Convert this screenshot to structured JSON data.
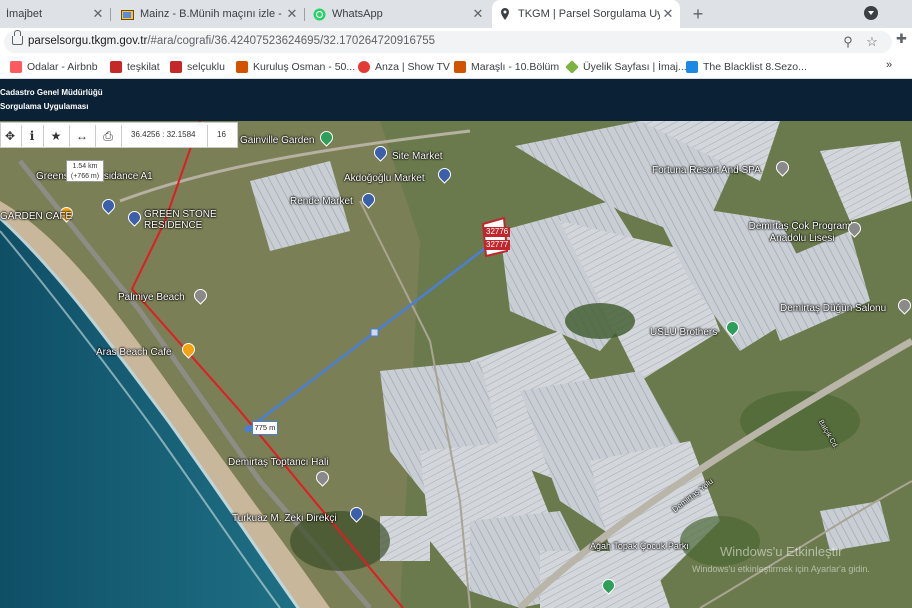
{
  "tabs": [
    {
      "label": "İmajbet",
      "icon": "generic-tab-icon"
    },
    {
      "label": "Mainz - B.Münih maçını izle - İmajbet",
      "icon": "tv-icon"
    },
    {
      "label": "WhatsApp",
      "icon": "whatsapp-icon"
    },
    {
      "label": "TKGM | Parsel Sorgulama Uygulaması",
      "icon": "location-pin-icon",
      "active": true
    }
  ],
  "url": {
    "host": "parselsorgu.tkgm.gov.tr",
    "path": "/#ara/cografi/36.42407523624695/32.170264720916755"
  },
  "bookmarks": [
    {
      "label": "Odalar - Airbnb",
      "color": "#ff5a5f"
    },
    {
      "label": "teşkilat",
      "color": "#c62828"
    },
    {
      "label": "selçuklu",
      "color": "#c62828"
    },
    {
      "label": "Kuruluş Osman - 50...",
      "color": "#d35400"
    },
    {
      "label": "Anza | Show TV",
      "color": "#e53935"
    },
    {
      "label": "Maraşlı - 10.Bölüm",
      "color": "#d35400"
    },
    {
      "label": "Üyelik Sayfası | İmaj...",
      "color": "#7cb342"
    },
    {
      "label": "The Blacklist 8.Sezo...",
      "color": "#1e88e5"
    }
  ],
  "bookmarks_more": "»",
  "app": {
    "title_line1": "Cadastro Genel Müdürlüğü",
    "title_line2": "Sorgulama Uygulaması"
  },
  "map_toolbar": {
    "coords": "36.4256 : 32.1584",
    "zoom": "16"
  },
  "scale": {
    "line1": "1.54 km",
    "line2": "(+766 m)"
  },
  "measure": {
    "distance": "775 m"
  },
  "parcels": [
    "32776",
    "32777"
  ],
  "places": [
    {
      "name": "Greenstone Residance A1",
      "color": "#3b5fa8"
    },
    {
      "name": "GREEN STONE RESIDENCE",
      "color": "#3b5fa8"
    },
    {
      "name": "GARDEN CAFE",
      "color": "#f2a30f"
    },
    {
      "name": "Palmiye Beach",
      "color": "#8a8a8a"
    },
    {
      "name": "Aras Beach Cafe",
      "color": "#f2a30f"
    },
    {
      "name": "Gainville Garden",
      "color": "#2e9e5b"
    },
    {
      "name": "Site Market",
      "color": "#3b5fa8"
    },
    {
      "name": "Akdoğoğlu Market",
      "color": "#3b5fa8"
    },
    {
      "name": "Rende Market",
      "color": "#3b5fa8"
    },
    {
      "name": "Fortuna Resort And SPA",
      "color": "#8a8a8a"
    },
    {
      "name": "Demirtaş Çok Programlı Anadolu Lisesi",
      "color": "#8a8a8a"
    },
    {
      "name": "Demirtaş Düğün Salonu",
      "color": "#8a8a8a"
    },
    {
      "name": "USLU Brothers",
      "color": "#2e9e5b"
    },
    {
      "name": "Demirtaş Toptancı Hali",
      "color": "#8a8a8a"
    },
    {
      "name": "Turkuaz M. Zeki Direkçi",
      "color": "#3b5fa8"
    },
    {
      "name": "Ağah Topak Çocuk Parkı",
      "color": "#2e9e5b"
    }
  ],
  "roads": [
    "Demirtaş Yolu",
    "Balçık Cd."
  ],
  "watermark": {
    "line1": "Windows'u Etkinleştir",
    "line2": "Windows'u etkinleştirmek için Ayarlar'a gidin."
  }
}
